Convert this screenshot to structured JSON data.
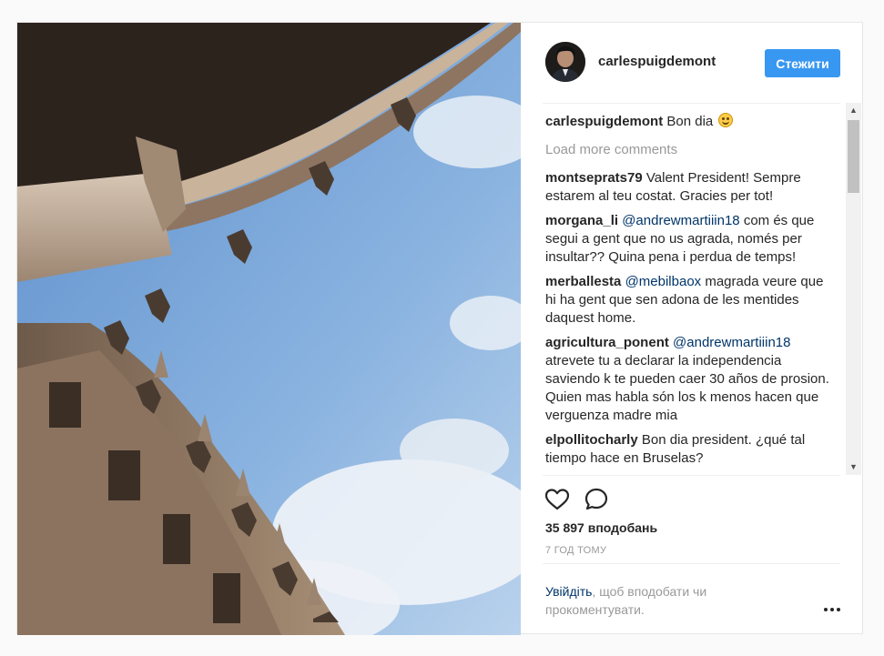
{
  "post": {
    "image_alt": "Gothic courtyard arches photographed from below against a blue sky",
    "author": {
      "username": "carlespuigdemont"
    },
    "follow_label": "Стежити",
    "caption": {
      "user": "carlespuigdemont",
      "text": "Bon dia",
      "emoji": "smiling-face-icon"
    },
    "load_more_label": "Load more comments",
    "comments": [
      {
        "user": "montseprats79",
        "mention": "",
        "text": "Valent President! Sempre estarem al teu costat. Gracies per tot!"
      },
      {
        "user": "morgana_li",
        "mention": "@andrewmartiiin18",
        "text": "com és que segui a gent que no us agrada, només per insultar?? Quina pena i perdua de temps!"
      },
      {
        "user": "merballesta",
        "mention": "@mebilbaox",
        "text": "magrada veure que hi ha gent que sen adona de les mentides daquest home."
      },
      {
        "user": "agricultura_ponent",
        "mention": "@andrewmartiiin18",
        "text": "atrevete tu a declarar la independencia saviendo k te pueden caer 30 años de prosion. Quien mas habla són los k menos hacen que verguenza madre mia"
      },
      {
        "user": "elpollitocharly",
        "mention": "",
        "text": "Bon dia president. ¿qué tal tiempo hace en Bruselas?"
      }
    ],
    "likes_label": "35 897 вподобань",
    "time_label": "7 ГОД ТОМУ",
    "login": {
      "link": "Увійдіть",
      "text": ", щоб вподобати чи прокоментувати."
    },
    "icons": {
      "like": "heart-icon",
      "comment": "comment-icon",
      "more": "more-options-icon"
    },
    "colors": {
      "accent": "#3897f0",
      "link": "#003569",
      "muted": "#999999",
      "text": "#262626"
    }
  }
}
